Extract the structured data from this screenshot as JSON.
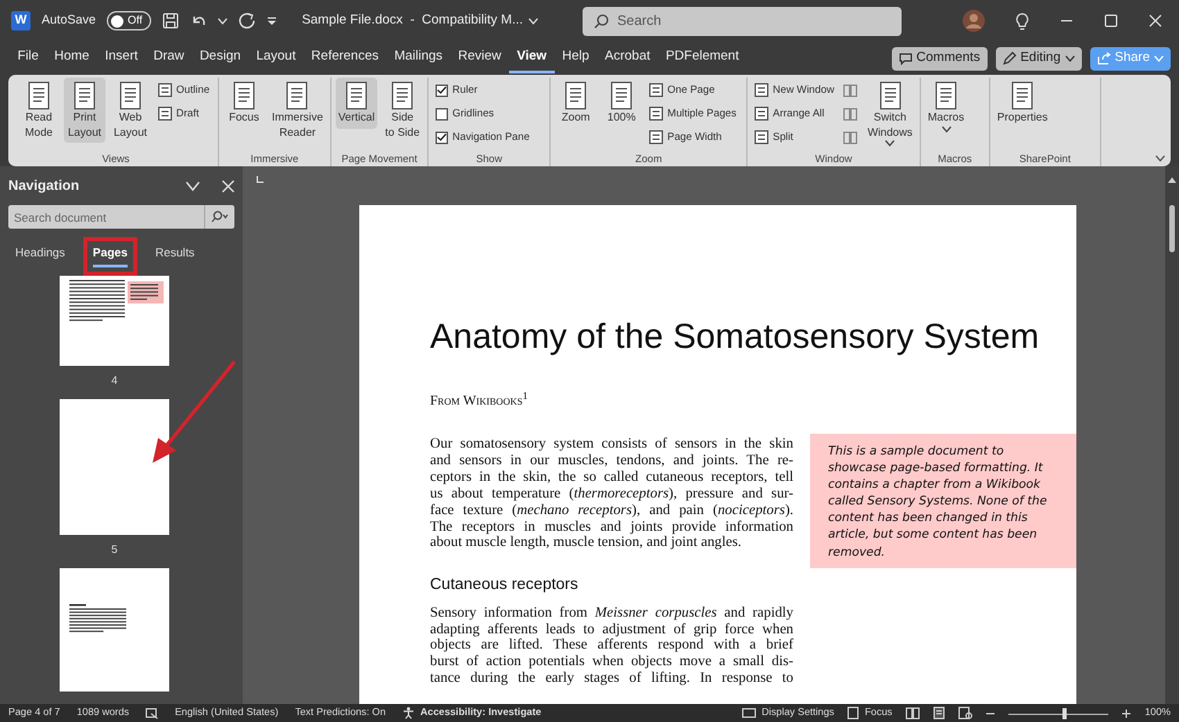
{
  "title_bar": {
    "app_logo": "W",
    "autosave_label": "AutoSave",
    "autosave": {
      "label": "Off",
      "on": false
    },
    "document_title": "Sample File.docx  -  Compatibility M...",
    "search_placeholder": "Search"
  },
  "menu_tabs": [
    {
      "label": "File",
      "selected": false
    },
    {
      "label": "Home",
      "selected": false
    },
    {
      "label": "Insert",
      "selected": false
    },
    {
      "label": "Draw",
      "selected": false
    },
    {
      "label": "Design",
      "selected": false
    },
    {
      "label": "Layout",
      "selected": false
    },
    {
      "label": "References",
      "selected": false
    },
    {
      "label": "Mailings",
      "selected": false
    },
    {
      "label": "Review",
      "selected": false
    },
    {
      "label": "View",
      "selected": true
    },
    {
      "label": "Help",
      "selected": false
    },
    {
      "label": "Acrobat",
      "selected": false
    },
    {
      "label": "PDFelement",
      "selected": false
    }
  ],
  "header_buttons": [
    {
      "label": "Comments",
      "kind": "comments"
    },
    {
      "label": "Editing",
      "kind": "editing"
    },
    {
      "label": "Share",
      "kind": "share"
    }
  ],
  "ribbon_groups": [
    {
      "label": "Views",
      "items": [
        {
          "kind": "large",
          "lines": [
            "Read",
            "Mode"
          ],
          "selected": false,
          "caret": false
        },
        {
          "kind": "large",
          "lines": [
            "Print",
            "Layout"
          ],
          "selected": true,
          "caret": false
        },
        {
          "kind": "large",
          "lines": [
            "Web",
            "Layout"
          ],
          "selected": false,
          "caret": false
        },
        {
          "kind": "small",
          "label": "Outline"
        },
        {
          "kind": "small",
          "label": "Draft"
        }
      ]
    },
    {
      "label": "Immersive",
      "items": [
        {
          "kind": "large",
          "lines": [
            "Focus"
          ],
          "selected": false,
          "caret": false
        },
        {
          "kind": "large",
          "lines": [
            "Immersive",
            "Reader"
          ],
          "selected": false,
          "caret": false
        }
      ]
    },
    {
      "label": "Page Movement",
      "items": [
        {
          "kind": "large",
          "lines": [
            "Vertical"
          ],
          "selected": true,
          "caret": false
        },
        {
          "kind": "large",
          "lines": [
            "Side",
            "to Side"
          ],
          "selected": false,
          "caret": false
        }
      ]
    },
    {
      "label": "Show",
      "items": [
        {
          "kind": "check",
          "label": "Ruler",
          "checked": true
        },
        {
          "kind": "check",
          "label": "Gridlines",
          "checked": false
        },
        {
          "kind": "check",
          "label": "Navigation Pane",
          "checked": true
        }
      ]
    },
    {
      "label": "Zoom",
      "items": [
        {
          "kind": "large",
          "lines": [
            "Zoom"
          ],
          "selected": false,
          "caret": false
        },
        {
          "kind": "large",
          "lines": [
            "100%"
          ],
          "selected": false,
          "caret": false
        },
        {
          "kind": "small",
          "label": "One Page"
        },
        {
          "kind": "small",
          "label": "Multiple Pages"
        },
        {
          "kind": "small",
          "label": "Page Width"
        }
      ]
    },
    {
      "label": "Window",
      "items": [
        {
          "kind": "small",
          "label": "New Window"
        },
        {
          "kind": "small",
          "label": "Arrange All"
        },
        {
          "kind": "small",
          "label": "Split"
        },
        {
          "kind": "icon"
        },
        {
          "kind": "icon"
        },
        {
          "kind": "icon"
        },
        {
          "kind": "large",
          "lines": [
            "Switch",
            "Windows"
          ],
          "selected": false,
          "caret": true
        }
      ]
    },
    {
      "label": "Macros",
      "items": [
        {
          "kind": "large",
          "lines": [
            "Macros"
          ],
          "selected": false,
          "caret": true
        }
      ]
    },
    {
      "label": "SharePoint",
      "items": [
        {
          "kind": "large",
          "lines": [
            "Properties"
          ],
          "selected": false,
          "caret": false
        }
      ]
    }
  ],
  "navigation": {
    "title": "Navigation",
    "search_placeholder": "Search document",
    "tabs": [
      {
        "label": "Headings",
        "selected": false,
        "highlighted": false
      },
      {
        "label": "Pages",
        "selected": true,
        "highlighted": true
      },
      {
        "label": "Results",
        "selected": false,
        "highlighted": false
      }
    ],
    "thumbnails": [
      {
        "kind": "text_with_note",
        "label": "4"
      },
      {
        "kind": "blank",
        "label": "5"
      },
      {
        "kind": "text"
      }
    ]
  },
  "document": {
    "title": "Anatomy of the Somatosensory System",
    "byline": "From Wikibooks$^{1}$",
    "paragraph_1": [
      "Our somatosensory system consists of sensors in the skin",
      "and sensors in our muscles, tendons, and joints. The re-",
      "ceptors in the skin, the so called cutaneous receptors, tell",
      "us about temperature (*thermoreceptors*), pressure and sur-",
      "face texture (*mechano receptors*), and pain (*nociceptors*).",
      "The receptors in muscles and joints provide information",
      "about muscle length, muscle tension, and joint angles."
    ],
    "heading": "Cutaneous receptors",
    "paragraph_2": [
      "Sensory information from *Meissner corpuscles* and rapidly",
      "adapting afferents leads to adjustment of grip force when",
      "objects are lifted. These afferents respond with a brief",
      "burst of action potentials when objects move a small dis-",
      "tance during the early stages of lifting. In response to"
    ],
    "note": [
      "This is a sample document to",
      "showcase page-based formatting. It",
      "contains a chapter from a Wikibook",
      "called Sensory Systems. None of the",
      "content has been changed in this",
      "article, but some content has been",
      "removed."
    ]
  },
  "status_bar": {
    "items": [
      {
        "kind": "text",
        "label": "Page 4 of 7"
      },
      {
        "kind": "text",
        "label": "1089 words"
      },
      {
        "kind": "icon"
      },
      {
        "kind": "text",
        "label": "English (United States)"
      },
      {
        "kind": "text",
        "label": "Text Predictions: On"
      },
      {
        "kind": "accessibility",
        "label": "Accessibility: Investigate"
      }
    ],
    "display_settings": "Display Settings",
    "focus": "Focus",
    "zoom": {
      "level": 0.56,
      "label": "100%"
    }
  }
}
